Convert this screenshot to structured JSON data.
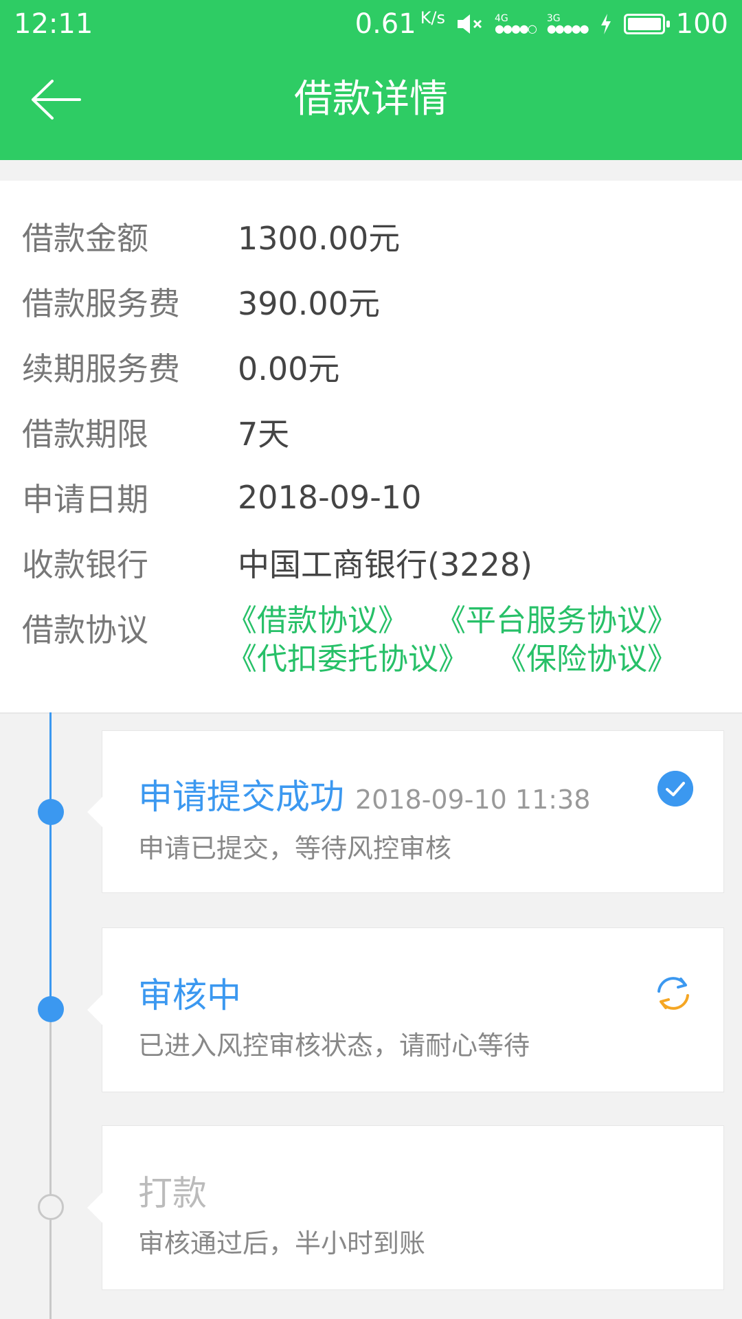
{
  "status_bar": {
    "time": "12:11",
    "net_speed": "0.61",
    "net_unit": "K/s",
    "network_1": "4G",
    "network_2": "3G",
    "battery": "100"
  },
  "appbar": {
    "title": "借款详情"
  },
  "details": {
    "rows": [
      {
        "label": "借款金额",
        "value": "1300.00元"
      },
      {
        "label": "借款服务费",
        "value": "390.00元"
      },
      {
        "label": "续期服务费",
        "value": "0.00元"
      },
      {
        "label": "借款期限",
        "value": "7天"
      },
      {
        "label": "申请日期",
        "value": "2018-09-10"
      },
      {
        "label": "收款银行",
        "value": "中国工商银行(3228)"
      }
    ],
    "agreement_label": "借款协议",
    "agreements": [
      "《借款协议》",
      "《平台服务协议》",
      "《代扣委托协议》",
      "《保险协议》"
    ]
  },
  "timeline": [
    {
      "title": "申请提交成功",
      "time": "2018-09-10 11:38",
      "desc": "申请已提交，等待风控审核",
      "status_icon": "check-circle-icon"
    },
    {
      "title": "审核中",
      "time": "",
      "desc": "已进入风控审核状态，请耐心等待",
      "status_icon": "refresh-icon"
    },
    {
      "title": "打款",
      "time": "",
      "desc": "审核通过后，半小时到账",
      "status_icon": ""
    }
  ],
  "colors": {
    "brand_green": "#2ecc64",
    "timeline_blue": "#3b98f0",
    "agreement_green": "#27c068",
    "refresh_orange": "#f5a623"
  }
}
